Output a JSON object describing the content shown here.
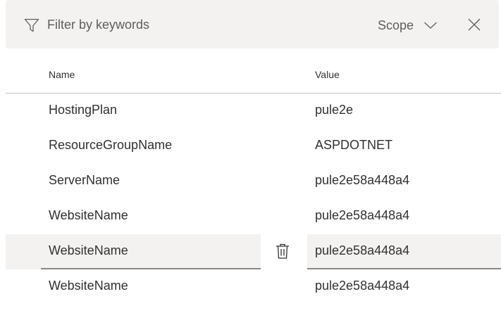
{
  "filter": {
    "placeholder": "Filter by keywords",
    "icon": "filter-icon"
  },
  "scope": {
    "label": "Scope",
    "icon": "chevron-down-icon"
  },
  "close": {
    "icon": "close-icon"
  },
  "table": {
    "columns": [
      "Name",
      "Value"
    ],
    "rows": [
      {
        "name": "HostingPlan",
        "value": "pule2e"
      },
      {
        "name": "ResourceGroupName",
        "value": "ASPDOTNET"
      },
      {
        "name": "ServerName",
        "value": "pule2e58a448a4"
      },
      {
        "name": "WebsiteName",
        "value": "pule2e58a448a4"
      },
      {
        "name": "WebsiteName",
        "value": "pule2e58a448a4",
        "selected": true
      },
      {
        "name": "WebsiteName",
        "value": "pule2e58a448a4"
      }
    ]
  },
  "row_actions": {
    "delete_icon": "trash-icon"
  }
}
